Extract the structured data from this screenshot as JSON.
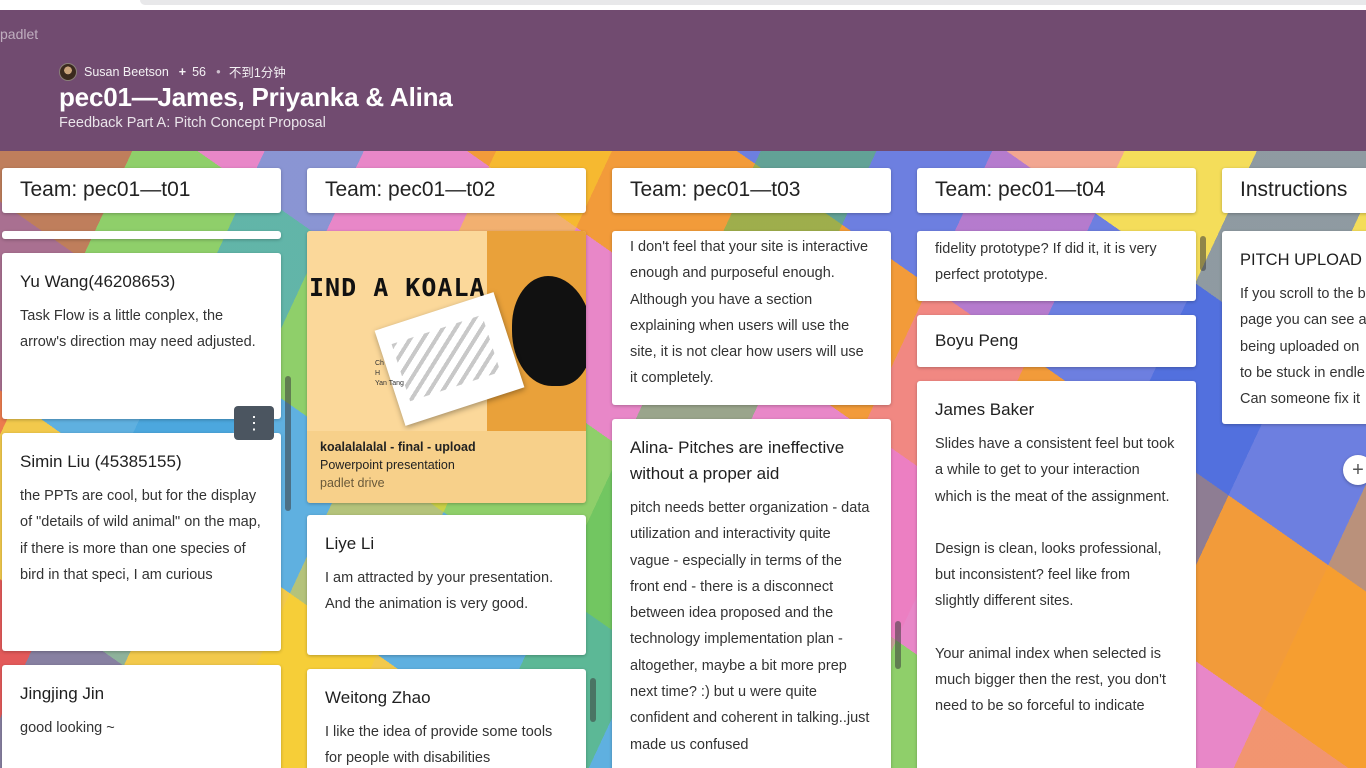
{
  "app": {
    "brand": "padlet"
  },
  "header": {
    "author": "Susan Beetson",
    "plus": "+",
    "count": "56",
    "time": "不到1分钟",
    "title": "pec01—James, Priyanka & Alina",
    "subtitle": "Feedback Part A: Pitch Concept Proposal"
  },
  "columns": [
    {
      "title": "Team: pec01—t01",
      "cards": [
        {
          "title": "Yu Wang(46208653)",
          "body": "Task Flow is a little conplex, the arrow's direction may need adjusted."
        },
        {
          "title": "Simin Liu (45385155)",
          "body": "the PPTs are cool, but for the display of \"details of wild animal\" on the map, if there is more than one species of bird in that speci, I am curious"
        },
        {
          "title": "Jingjing Jin",
          "body": "good looking ~"
        }
      ],
      "more_icon": "more-vertical-icon"
    },
    {
      "title": "Team: pec01—t02",
      "attachment": {
        "image_text": "IND A KOALA",
        "image_small_text": "Ch\nH\nYan Tang",
        "name": "koalalalalal - final - upload",
        "type": "Powerpoint presentation",
        "source": "padlet drive"
      },
      "cards": [
        {
          "title": "Liye Li",
          "body": "I am attracted by your presentation. And the animation is very good."
        },
        {
          "title": "Weitong Zhao",
          "body": "I like the idea of provide some tools for people with disabilities"
        }
      ]
    },
    {
      "title": "Team: pec01—t03",
      "cards": [
        {
          "title": "",
          "body": "I don't feel that your site is interactive enough and purposeful enough. Although you have a section explaining when users will use the site, it is not clear how users will use it completely."
        },
        {
          "title": "Alina- Pitches are ineffective without a proper aid",
          "body": "pitch needs better organization - data utilization and interactivity quite vague - especially in terms of the front end - there is a disconnect between idea proposed and the technology implementation plan - altogether, maybe a bit more prep next time? :) but u were quite confident and coherent in talking..just made us confused"
        }
      ]
    },
    {
      "title": "Team: pec01—t04",
      "cards": [
        {
          "title": "",
          "body": "fidelity prototype? If did it, it is very perfect prototype."
        },
        {
          "title": "Boyu Peng",
          "body": ""
        },
        {
          "title": "James Baker",
          "body_lines": [
            "Slides have a consistent feel but took a while to get to your interaction which is the meat of the assignment.",
            "Design is clean, looks professional, but inconsistent? feel like from slightly different sites.",
            "Your animal index when selected is much bigger then the rest, you don't need to be so forceful to indicate"
          ]
        }
      ]
    },
    {
      "title": "Instructions",
      "cards": [
        {
          "title": "PITCH UPLOAD",
          "body": "If you scroll to the b page you can see a being uploaded on to be stuck in endle Can someone fix it"
        }
      ],
      "add_icon": "plus-icon"
    }
  ]
}
